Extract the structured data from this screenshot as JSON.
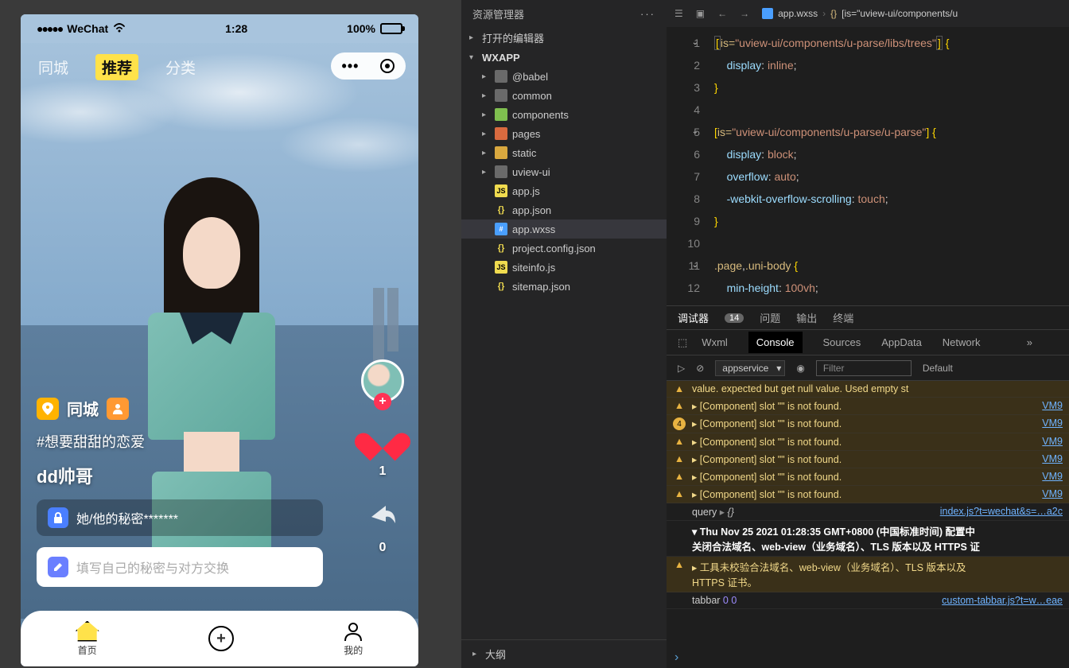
{
  "phone": {
    "status": {
      "carrier": "WeChat",
      "time": "1:28",
      "battery": "100%"
    },
    "tabs": [
      "同城",
      "推荐",
      "分类"
    ],
    "activeTab": "推荐",
    "overlay": {
      "location": "同城",
      "hashtag": "#想要甜甜的恋爱",
      "username": "dd帅哥",
      "secret": "她/他的秘密*******",
      "inputPlaceholder": "填写自己的秘密与对方交换",
      "likes": "1",
      "shares": "0"
    },
    "tabbar": {
      "home": "首页",
      "mine": "我的"
    }
  },
  "explorer": {
    "title": "资源管理器",
    "openEditors": "打开的编辑器",
    "project": "WXAPP",
    "nodes": [
      {
        "label": "@babel",
        "icon": "folder"
      },
      {
        "label": "common",
        "icon": "folder"
      },
      {
        "label": "components",
        "icon": "folder-g"
      },
      {
        "label": "pages",
        "icon": "folder-r"
      },
      {
        "label": "static",
        "icon": "folder-y"
      },
      {
        "label": "uview-ui",
        "icon": "folder"
      },
      {
        "label": "app.js",
        "icon": "js"
      },
      {
        "label": "app.json",
        "icon": "json"
      },
      {
        "label": "app.wxss",
        "icon": "wxss",
        "selected": true
      },
      {
        "label": "project.config.json",
        "icon": "json"
      },
      {
        "label": "siteinfo.js",
        "icon": "js"
      },
      {
        "label": "sitemap.json",
        "icon": "json"
      }
    ],
    "outline": "大纲"
  },
  "editor": {
    "tab": "app.wxss",
    "breadcrumb": "[is=\"uview-ui/components/u",
    "code": [
      {
        "n": 1,
        "fold": true,
        "html": "<span class='tok-brace hl'>[</span><span class='tok-sel'>is=</span><span class='tok-str'>\"uview-ui/components/u-parse/libs/trees\"</span><span class='tok-brace hl'>]</span> <span class='tok-brace'>{</span>"
      },
      {
        "n": 2,
        "html": "    <span class='tok-prop'>display</span>: <span class='tok-val'>inline</span>;"
      },
      {
        "n": 3,
        "html": "<span class='tok-brace'>}</span>"
      },
      {
        "n": 4,
        "html": ""
      },
      {
        "n": 5,
        "fold": true,
        "html": "<span class='tok-brace'>[</span><span class='tok-sel'>is=</span><span class='tok-str'>\"uview-ui/components/u-parse/u-parse\"</span><span class='tok-brace'>]</span> <span class='tok-brace'>{</span>"
      },
      {
        "n": 6,
        "html": "    <span class='tok-prop'>display</span>: <span class='tok-val'>block</span>;"
      },
      {
        "n": 7,
        "html": "    <span class='tok-prop'>overflow</span>: <span class='tok-val'>auto</span>;"
      },
      {
        "n": 8,
        "html": "    <span class='tok-prop'>-webkit-overflow-scrolling</span>: <span class='tok-val'>touch</span>;"
      },
      {
        "n": 9,
        "html": "<span class='tok-brace'>}</span>"
      },
      {
        "n": 10,
        "html": ""
      },
      {
        "n": 11,
        "fold": true,
        "html": "<span class='tok-sel'>.page</span>,<span class='tok-sel'>.uni-body</span> <span class='tok-brace'>{</span>"
      },
      {
        "n": 12,
        "html": "    <span class='tok-prop'>min-height</span>: <span class='tok-val'>100vh</span>;"
      }
    ]
  },
  "devtools": {
    "topTabs": {
      "debug": "调试器",
      "badge": "14",
      "problems": "问题",
      "output": "输出",
      "terminal": "终端"
    },
    "subTabs": [
      "Wxml",
      "Console",
      "Sources",
      "AppData",
      "Network"
    ],
    "activeSub": "Console",
    "context": "appservice",
    "filterPlaceholder": "Filter",
    "levels": "Default",
    "rows": [
      {
        "type": "warn-cut",
        "text": "value. expected <String> but get null value. Used empty st"
      },
      {
        "type": "warn",
        "text": "▸ [Component] slot \"\" is not found.",
        "src": "VM9"
      },
      {
        "type": "warn4",
        "text": "▸ [Component] slot \"\" is not found.",
        "src": "VM9"
      },
      {
        "type": "warn",
        "text": "▸ [Component] slot \"\" is not found.",
        "src": "VM9"
      },
      {
        "type": "warn",
        "text": "▸ [Component] slot \"\" is not found.",
        "src": "VM9"
      },
      {
        "type": "warn",
        "text": "▸ [Component] slot \"\" is not found.",
        "src": "VM9"
      },
      {
        "type": "warn",
        "text": "▸ [Component] slot \"\" is not found.",
        "src": "VM9"
      },
      {
        "type": "log",
        "text": "query ▸ {}",
        "src": "index.js?t=wechat&s=…a2c"
      },
      {
        "type": "log-multi",
        "lines": [
          "▾ Thu Nov 25 2021 01:28:35 GMT+0800 (中国标准时间) 配置中",
          "  关闭合法域名、web-view（业务域名）、TLS 版本以及 HTTPS 证"
        ]
      },
      {
        "type": "warn-multi",
        "lines": [
          "▸ 工具未校验合法域名、web-view（业务域名）、TLS 版本以及",
          "  HTTPS 证书。"
        ]
      },
      {
        "type": "log",
        "text": "tabbar 0 0",
        "src": "custom-tabbar.js?t=w…eae",
        "nums": true
      }
    ]
  }
}
